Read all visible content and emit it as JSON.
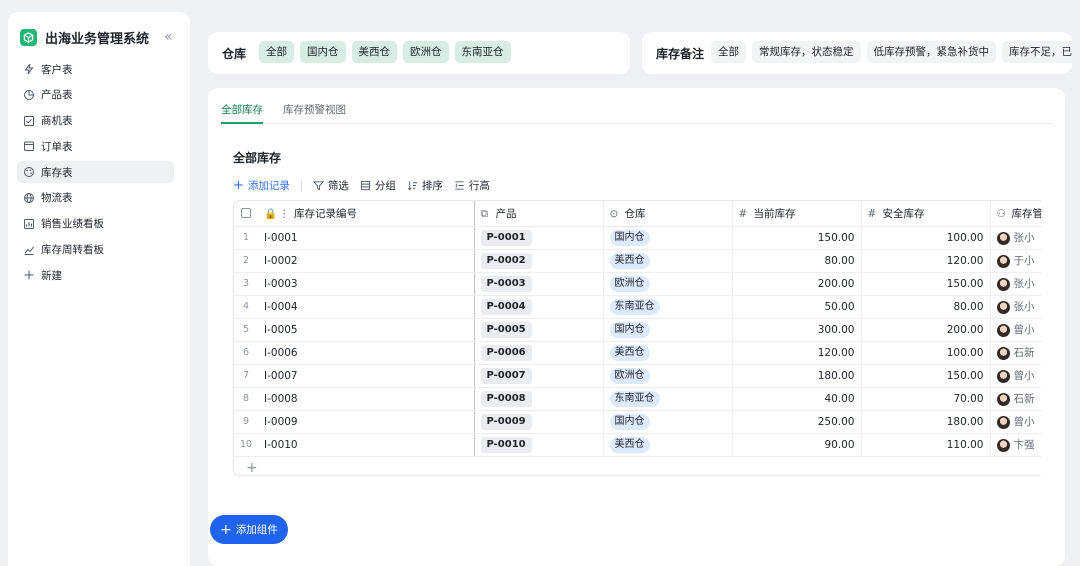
{
  "app": {
    "title": "出海业务管理系统",
    "collapse_glyph": "«"
  },
  "sidebar": {
    "items": [
      {
        "label": "客户表",
        "icon": "lightning-icon"
      },
      {
        "label": "产品表",
        "icon": "pie-icon"
      },
      {
        "label": "商机表",
        "icon": "checkbox-icon"
      },
      {
        "label": "订单表",
        "icon": "calendar-icon"
      },
      {
        "label": "库存表",
        "icon": "palette-icon",
        "active": true
      },
      {
        "label": "物流表",
        "icon": "globe-icon"
      },
      {
        "label": "销售业绩看板",
        "icon": "dashboard-icon"
      },
      {
        "label": "库存周转看板",
        "icon": "chart-icon"
      },
      {
        "label": "新建",
        "icon": "plus-icon"
      }
    ]
  },
  "filter_warehouse": {
    "label": "仓库",
    "options": [
      "全部",
      "国内仓",
      "美西仓",
      "欧洲仓",
      "东南亚仓"
    ]
  },
  "filter_note": {
    "label": "库存备注",
    "options": [
      "全部",
      "常规库存，状态稳定",
      "低库存预警，紧急补货中",
      "库存不足，已触"
    ]
  },
  "tabs": [
    "全部库存",
    "库存预警视图"
  ],
  "view_title": "全部库存",
  "toolbar": {
    "add": "添加记录",
    "filter": "筛选",
    "group": "分组",
    "sort": "排序",
    "row_height": "行高"
  },
  "table": {
    "columns": [
      "库存记录编号",
      "产品",
      "仓库",
      "当前库存",
      "安全库存",
      "库存管"
    ],
    "rows": [
      {
        "idx": "1",
        "id": "I-0001",
        "product": "P-0001",
        "warehouse": "国内仓",
        "current": "150.00",
        "safety": "100.00",
        "manager": "张小"
      },
      {
        "idx": "2",
        "id": "I-0002",
        "product": "P-0002",
        "warehouse": "美西仓",
        "current": "80.00",
        "safety": "120.00",
        "manager": "于小"
      },
      {
        "idx": "3",
        "id": "I-0003",
        "product": "P-0003",
        "warehouse": "欧洲仓",
        "current": "200.00",
        "safety": "150.00",
        "manager": "张小"
      },
      {
        "idx": "4",
        "id": "I-0004",
        "product": "P-0004",
        "warehouse": "东南亚仓",
        "current": "50.00",
        "safety": "80.00",
        "manager": "张小"
      },
      {
        "idx": "5",
        "id": "I-0005",
        "product": "P-0005",
        "warehouse": "国内仓",
        "current": "300.00",
        "safety": "200.00",
        "manager": "曾小"
      },
      {
        "idx": "6",
        "id": "I-0006",
        "product": "P-0006",
        "warehouse": "美西仓",
        "current": "120.00",
        "safety": "100.00",
        "manager": "石新"
      },
      {
        "idx": "7",
        "id": "I-0007",
        "product": "P-0007",
        "warehouse": "欧洲仓",
        "current": "180.00",
        "safety": "150.00",
        "manager": "曾小"
      },
      {
        "idx": "8",
        "id": "I-0008",
        "product": "P-0008",
        "warehouse": "东南亚仓",
        "current": "40.00",
        "safety": "70.00",
        "manager": "石新"
      },
      {
        "idx": "9",
        "id": "I-0009",
        "product": "P-0009",
        "warehouse": "国内仓",
        "current": "250.00",
        "safety": "180.00",
        "manager": "曾小"
      },
      {
        "idx": "10",
        "id": "I-0010",
        "product": "P-0010",
        "warehouse": "美西仓",
        "current": "90.00",
        "safety": "110.00",
        "manager": "卞强"
      }
    ],
    "add_row_glyph": "+"
  },
  "add_widget": "添加组件",
  "colors": {
    "brand": "#22b573",
    "primary": "#1f63f0",
    "tab_active": "#1a7f52",
    "chip_green": "#d7ede4"
  }
}
